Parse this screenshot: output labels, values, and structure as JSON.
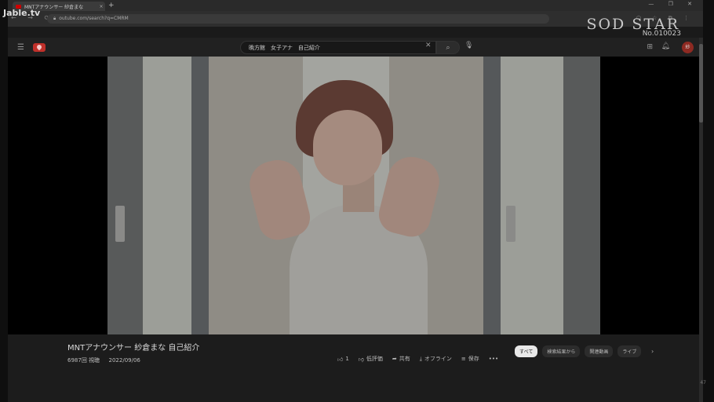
{
  "watermark": {
    "site": "Jable.tv",
    "studio_logo": "SOD STAR",
    "code": "No.010023"
  },
  "browser": {
    "tab_title": "MNTアナウンサー 紗倉まな",
    "tab_close": "×",
    "new_tab": "+",
    "window_buttons": "— ❐ ✕",
    "url": "outube.com/search?q=CMRM"
  },
  "youtube": {
    "search_query": "晩方館　女子アナ　自己紹介",
    "search_placeholder": "検索",
    "avatar_text": "紗"
  },
  "video": {
    "title": "MNTアナウンサー 紗倉まな 自己紹介",
    "views": "6987回 視聴",
    "date": "2022/09/06",
    "actions": {
      "like_count": "1",
      "dislike": "低評価",
      "share": "共有",
      "offline": "オフライン",
      "save": "保存",
      "more": "•••"
    }
  },
  "chips": [
    "すべて",
    "検索結果から",
    "関連動画",
    "ライブ"
  ],
  "misc": {
    "corner_num": "47"
  }
}
